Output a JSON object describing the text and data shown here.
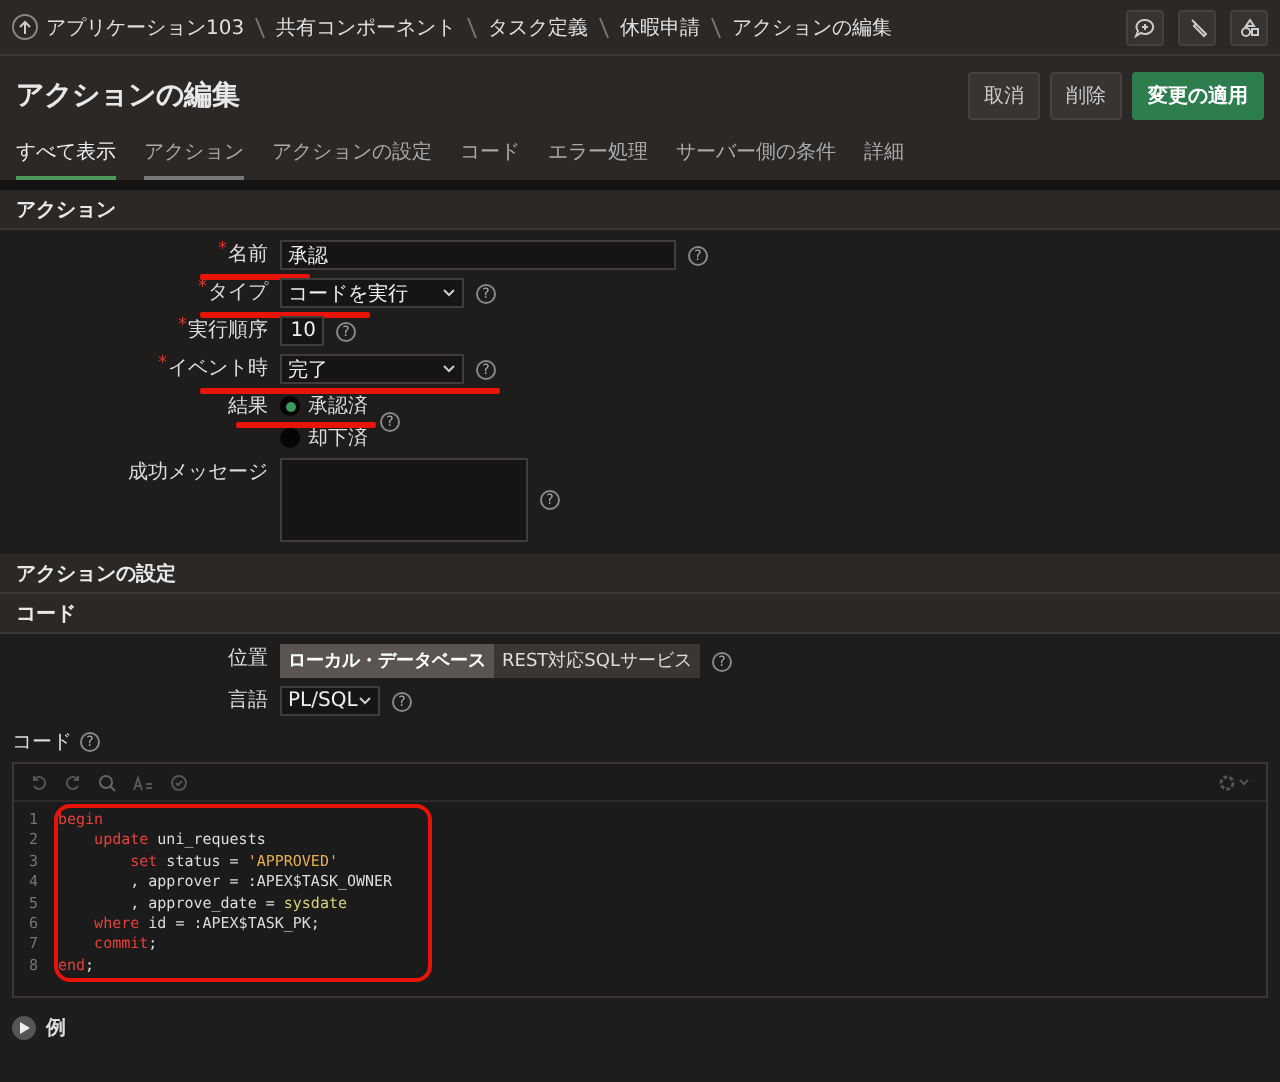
{
  "breadcrumb": [
    "アプリケーション103",
    "共有コンポーネント",
    "タスク定義",
    "休暇申請",
    "アクションの編集"
  ],
  "page_title": "アクションの編集",
  "header_buttons": [
    {
      "label": "取消",
      "kind": "plain"
    },
    {
      "label": "削除",
      "kind": "plain"
    },
    {
      "label": "変更の適用",
      "kind": "primary"
    }
  ],
  "tabs": [
    {
      "label": "すべて表示",
      "selected": true,
      "hovered": false
    },
    {
      "label": "アクション",
      "selected": false,
      "hovered": true
    },
    {
      "label": "アクションの設定",
      "selected": false,
      "hovered": false
    },
    {
      "label": "コード",
      "selected": false,
      "hovered": false
    },
    {
      "label": "エラー処理",
      "selected": false,
      "hovered": false
    },
    {
      "label": "サーバー側の条件",
      "selected": false,
      "hovered": false
    },
    {
      "label": "詳細",
      "selected": false,
      "hovered": false
    }
  ],
  "action_section": {
    "title": "アクション",
    "fields": [
      {
        "kind": "text",
        "label": "名前",
        "required_mark": "*",
        "value": "承認",
        "help": "?",
        "underlined": true
      },
      {
        "kind": "select",
        "label": "タイプ",
        "required_mark": "*",
        "value": "コードを実行",
        "help": "?",
        "underlined": true
      },
      {
        "kind": "number",
        "label": "実行順序",
        "required_mark": "*",
        "value": "10",
        "help": "?"
      },
      {
        "kind": "select",
        "label": "イベント時",
        "required_mark": "*",
        "value": "完了",
        "help": "?",
        "underlined": true
      },
      {
        "kind": "radio",
        "label": "結果",
        "help": "?",
        "underlined": true,
        "options": [
          {
            "label": "承認済",
            "selected": true
          },
          {
            "label": "却下済",
            "selected": false
          }
        ]
      },
      {
        "kind": "textarea",
        "label": "成功メッセージ",
        "help": "?"
      }
    ]
  },
  "settings_section": {
    "title": "アクションの設定"
  },
  "code_section": {
    "title": "コード",
    "location": {
      "label": "位置",
      "help": "?",
      "options": [
        {
          "label": "ローカル・データベース",
          "selected": true
        },
        {
          "label": "REST対応SQLサービス",
          "selected": false
        }
      ]
    },
    "language": {
      "label": "言語",
      "value": "PL/SQL",
      "help": "?"
    },
    "code_label": "コード",
    "code_help": "?",
    "highlighted": true,
    "lines": [
      {
        "number": "1",
        "tokens": [
          {
            "text": "begin",
            "kind": "keyword"
          }
        ]
      },
      {
        "number": "2",
        "tokens": [
          {
            "text": "    update",
            "kind": "keyword"
          },
          {
            "text": " uni_requests",
            "kind": "plain"
          }
        ]
      },
      {
        "number": "3",
        "tokens": [
          {
            "text": "        set",
            "kind": "keyword"
          },
          {
            "text": " status = ",
            "kind": "plain"
          },
          {
            "text": "'APPROVED'",
            "kind": "string"
          }
        ]
      },
      {
        "number": "4",
        "tokens": [
          {
            "text": "        , approver = :APEX$TASK_OWNER",
            "kind": "plain"
          }
        ]
      },
      {
        "number": "5",
        "tokens": [
          {
            "text": "        , approve_date = ",
            "kind": "plain"
          },
          {
            "text": "sysdate",
            "kind": "function"
          }
        ]
      },
      {
        "number": "6",
        "tokens": [
          {
            "text": "    where",
            "kind": "keyword"
          },
          {
            "text": " id = :APEX$TASK_PK;",
            "kind": "plain"
          }
        ]
      },
      {
        "number": "7",
        "tokens": [
          {
            "text": "    commit",
            "kind": "keyword"
          },
          {
            "text": ";",
            "kind": "plain"
          }
        ]
      },
      {
        "number": "8",
        "tokens": [
          {
            "text": "end",
            "kind": "keyword"
          },
          {
            "text": ";",
            "kind": "plain"
          }
        ]
      }
    ]
  },
  "example": {
    "label": "例"
  }
}
